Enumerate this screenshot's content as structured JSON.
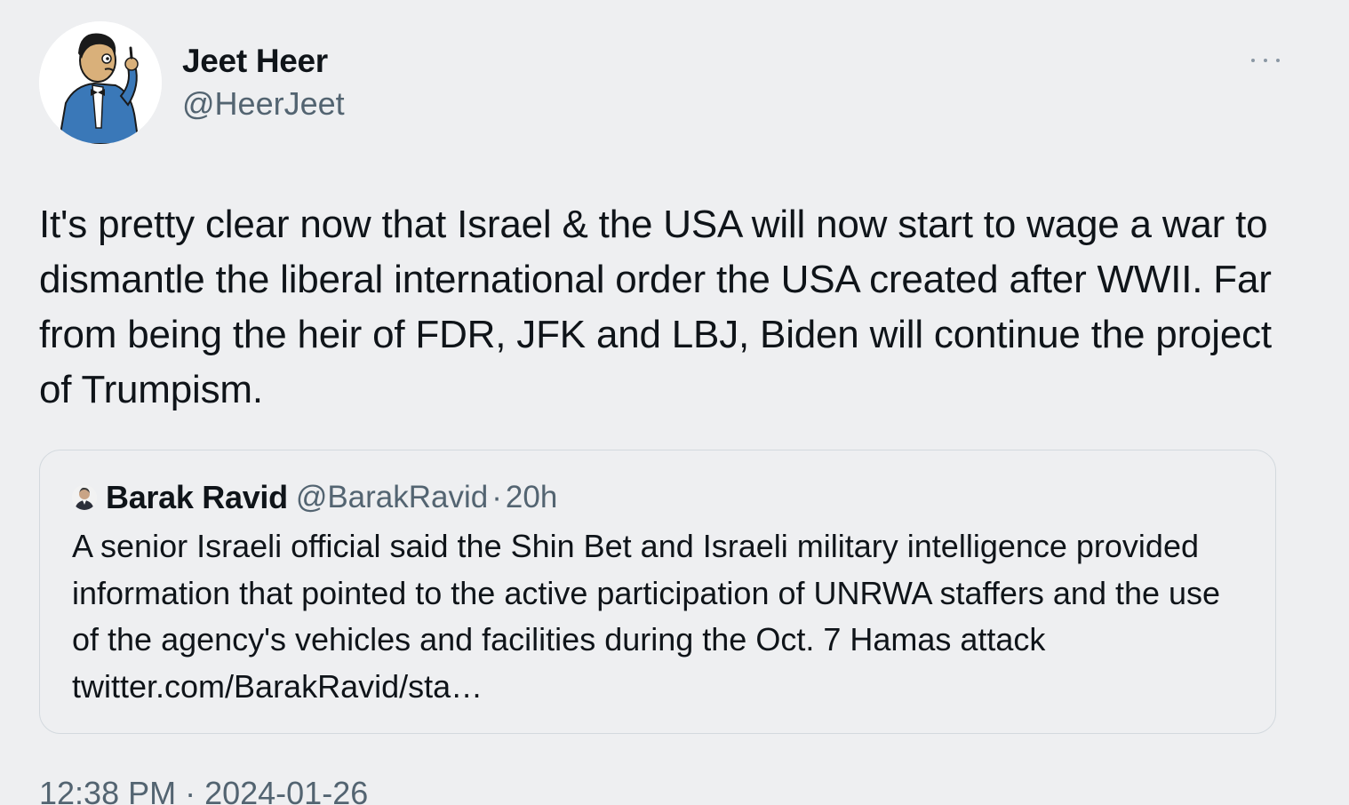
{
  "author": {
    "name": "Jeet Heer",
    "handle": "@HeerJeet"
  },
  "icons": {
    "more": "more-horizontal-icon",
    "avatar": "avatar-cartoon-man-in-blue-suit"
  },
  "tweet": {
    "text": "It's pretty clear now that Israel & the USA will now start to wage a war to dismantle the liberal international order the USA created after WWII. Far from being the heir of FDR, JFK and LBJ, Biden will continue the project of Trumpism."
  },
  "quoted": {
    "name": "Barak Ravid",
    "handle": "@BarakRavid",
    "separator": "·",
    "time": "20h",
    "text": "A senior Israeli official said the Shin Bet and Israeli military intelligence provided information that pointed to the active participation of UNRWA staffers and the use of the agency's vehicles and facilities during the Oct. 7 Hamas attack twitter.com/BarakRavid/sta…"
  },
  "footer": {
    "timestamp": "12:38 PM · 2024-01-26"
  },
  "colors": {
    "background": "#eeeff1",
    "text": "#0f1419",
    "secondary": "#536471",
    "border": "#d3d9de"
  }
}
